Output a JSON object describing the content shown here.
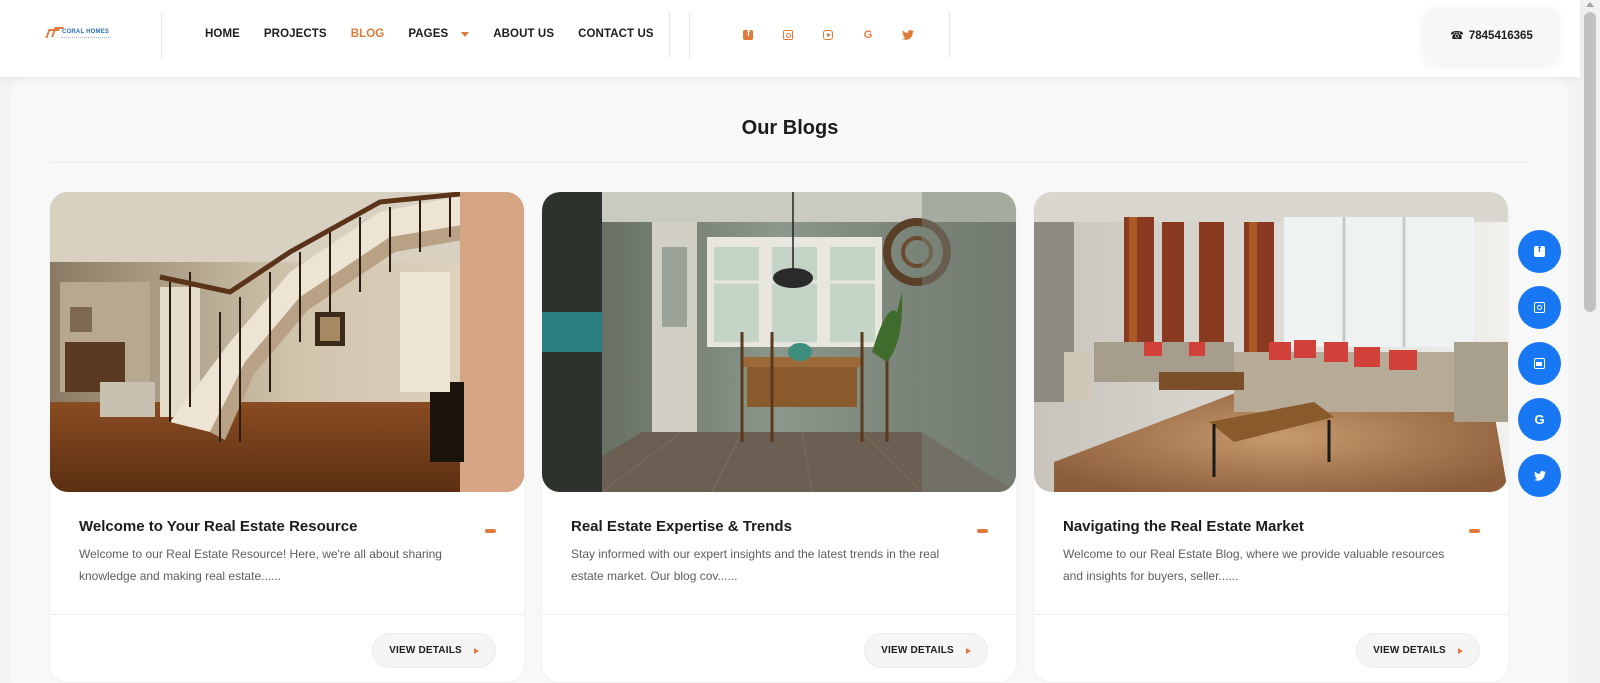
{
  "header": {
    "logo_text": "CORAL HOMES",
    "nav": [
      {
        "label": "HOME",
        "active": false
      },
      {
        "label": "PROJECTS",
        "active": false
      },
      {
        "label": "BLOG",
        "active": true
      },
      {
        "label": "PAGES",
        "active": false,
        "has_dropdown": true
      },
      {
        "label": "ABOUT US",
        "active": false
      },
      {
        "label": "CONTACT US",
        "active": false
      }
    ],
    "socials": [
      "facebook-icon",
      "instagram-icon",
      "youtube-icon",
      "google-icon",
      "twitter-icon"
    ],
    "phone": "7845416365"
  },
  "main": {
    "title": "Our Blogs",
    "cards": [
      {
        "title": "Welcome to Your Real Estate Resource",
        "excerpt": "Welcome to our Real Estate Resource! Here, we're all about sharing knowledge and making real estate......",
        "button": "VIEW DETAILS"
      },
      {
        "title": "Real Estate Expertise & Trends",
        "excerpt": "Stay informed with our expert insights and the latest trends in the real estate market. Our blog cov......",
        "button": "VIEW DETAILS"
      },
      {
        "title": "Navigating the Real Estate Market",
        "excerpt": "Welcome to our Real Estate Blog, where we provide valuable resources and insights for buyers, seller......",
        "button": "VIEW DETAILS"
      }
    ]
  },
  "floating_social": [
    "facebook-icon",
    "instagram-icon",
    "youtube-icon",
    "google-icon",
    "twitter-icon"
  ],
  "colors": {
    "accent": "#e07a3a",
    "social_blue": "#1877f2",
    "text": "#1c1c1c"
  }
}
